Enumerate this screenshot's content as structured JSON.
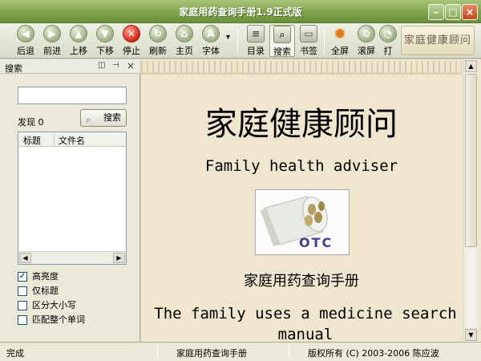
{
  "window": {
    "title": "家庭用药查询手册1.9正式版",
    "min_glyph": "–",
    "max_glyph": "□",
    "close_glyph": "×"
  },
  "toolbar": {
    "buttons": [
      {
        "label": "后退",
        "icon": "back-icon",
        "glyph": "◀"
      },
      {
        "label": "前进",
        "icon": "forward-icon",
        "glyph": "▶"
      },
      {
        "label": "上移",
        "icon": "up-icon",
        "glyph": "▲"
      },
      {
        "label": "下移",
        "icon": "down-icon",
        "glyph": "▼"
      },
      {
        "label": "停止",
        "icon": "stop-icon",
        "glyph": "✕"
      },
      {
        "label": "刷新",
        "icon": "refresh-icon",
        "glyph": "↻"
      },
      {
        "label": "主页",
        "icon": "home-icon",
        "glyph": "⌂"
      },
      {
        "label": "字体",
        "icon": "font-icon",
        "glyph": "A"
      },
      {
        "label": "目录",
        "icon": "contents-icon",
        "glyph": "≡"
      },
      {
        "label": "搜索",
        "icon": "search-icon",
        "glyph": "⌕"
      },
      {
        "label": "书签",
        "icon": "bookmark-icon",
        "glyph": "▭"
      },
      {
        "label": "全屏",
        "icon": "fullscreen-icon",
        "glyph": "✹"
      },
      {
        "label": "滚屏",
        "icon": "scroll-icon",
        "glyph": "⚙"
      },
      {
        "label": "打",
        "icon": "print-icon",
        "glyph": "◔"
      }
    ],
    "font_dropdown_glyph": "▾",
    "brand": "家庭健康顾问"
  },
  "search_panel": {
    "title": "搜索",
    "pin_glyph": "◫",
    "autohide_glyph": "⊣",
    "close_glyph": "×",
    "query": "",
    "found_label": "发现 0",
    "search_button": "搜索",
    "search_button_glyph": "⌕",
    "columns": [
      "标题",
      "文件名"
    ],
    "scroll_left_glyph": "◀",
    "scroll_right_glyph": "▶",
    "options": [
      {
        "label": "高亮度",
        "checked": true
      },
      {
        "label": "仅标题",
        "checked": false
      },
      {
        "label": "区分大小写",
        "checked": false
      },
      {
        "label": "匹配整个单词",
        "checked": false
      }
    ],
    "check_glyph": "✓"
  },
  "content": {
    "title_cn": "家庭健康顾问",
    "title_en": "Family health adviser",
    "image_label": "OTC",
    "subtitle_cn": "家庭用药查询手册",
    "subtitle_en": "The family uses a medicine search manual",
    "scroll_up_glyph": "▲",
    "scroll_down_glyph": "▼"
  },
  "status": {
    "left": "完成",
    "middle": "家庭用药查询手册",
    "right": "版权所有 (C) 2003-2006 陈应波"
  }
}
